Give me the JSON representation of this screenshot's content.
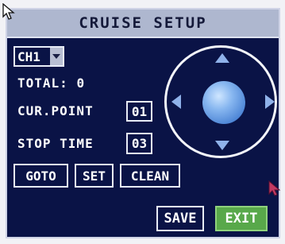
{
  "window": {
    "title": "CRUISE SETUP"
  },
  "channel": {
    "selected": "CH1"
  },
  "total": {
    "label": "TOTAL:",
    "value": "0"
  },
  "cur_point": {
    "label": "CUR.POINT",
    "value": "01"
  },
  "stop_time": {
    "label": "STOP TIME",
    "value": "03"
  },
  "actions": {
    "goto": "GOTO",
    "set": "SET",
    "clean": "CLEAN"
  },
  "footer": {
    "save": "SAVE",
    "exit": "EXIT"
  },
  "icons": {
    "cursor": "mouse-cursor-icon",
    "dropdown": "chevron-down-icon",
    "ptz_up": "arrow-up-icon",
    "ptz_down": "arrow-down-icon",
    "ptz_left": "arrow-left-icon",
    "ptz_right": "arrow-right-icon",
    "center": "ptz-center-knob",
    "pointer": "pointer-icon"
  },
  "colors": {
    "panel_bg": "#0a1346",
    "title_bar": "#aeb7cf",
    "ptz_arrow": "#8fb2ea",
    "exit_bg": "#58a84a",
    "pointer": "#c23a63"
  }
}
